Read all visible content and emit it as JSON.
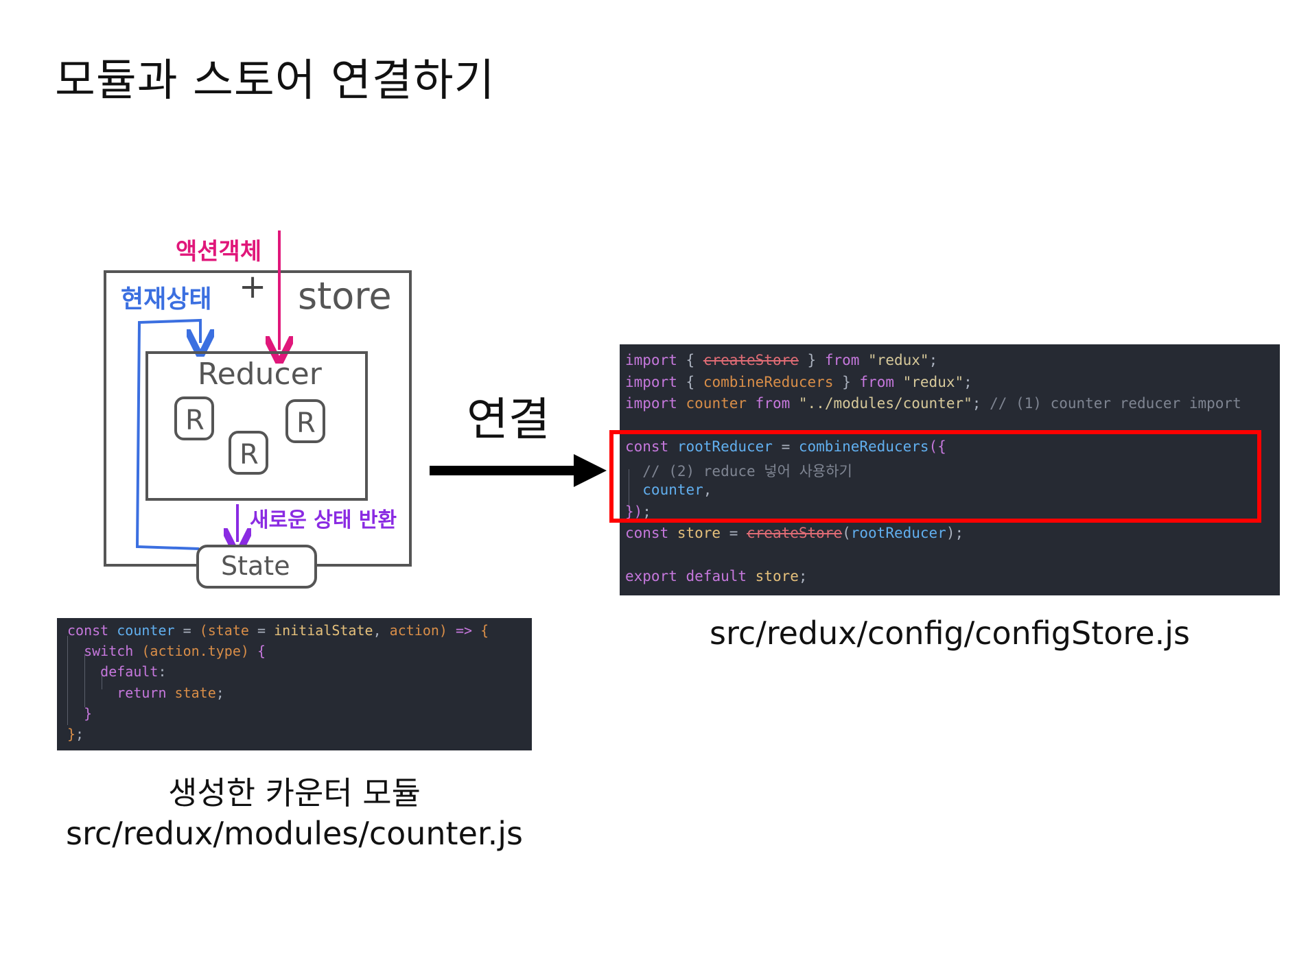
{
  "title": "모듈과 스토어 연결하기",
  "diagram": {
    "action_label": "액션객체",
    "current_state_label": "현재상태",
    "plus": "+",
    "store_label": "store",
    "reducer_label": "Reducer",
    "r_label": "R",
    "new_state_label": "새로운 상태 반환",
    "state_label": "State"
  },
  "connect_label": "연결",
  "config_code": {
    "lines": [
      [
        {
          "t": "import ",
          "c": "kw"
        },
        {
          "t": "{ ",
          "c": "pl"
        },
        {
          "t": "createStore",
          "c": "del"
        },
        {
          "t": " } ",
          "c": "pl"
        },
        {
          "t": "from ",
          "c": "kw"
        },
        {
          "t": "\"redux\"",
          "c": "str"
        },
        {
          "t": ";",
          "c": "pl"
        }
      ],
      [
        {
          "t": "import ",
          "c": "kw"
        },
        {
          "t": "{ ",
          "c": "pl"
        },
        {
          "t": "combineReducers",
          "c": "par"
        },
        {
          "t": " } ",
          "c": "pl"
        },
        {
          "t": "from ",
          "c": "kw"
        },
        {
          "t": "\"redux\"",
          "c": "str"
        },
        {
          "t": ";",
          "c": "pl"
        }
      ],
      [
        {
          "t": "import ",
          "c": "kw"
        },
        {
          "t": "counter ",
          "c": "par"
        },
        {
          "t": "from ",
          "c": "kw"
        },
        {
          "t": "\"../modules/counter\"",
          "c": "str"
        },
        {
          "t": "; ",
          "c": "pl"
        },
        {
          "t": "// (1) counter reducer import",
          "c": "cm"
        }
      ],
      [],
      [
        {
          "t": "const ",
          "c": "kw"
        },
        {
          "t": "rootReducer ",
          "c": "fn"
        },
        {
          "t": "= ",
          "c": "pl"
        },
        {
          "t": "combineReducers",
          "c": "fn"
        },
        {
          "t": "({",
          "c": "kw"
        }
      ],
      [
        {
          "t": "  // (2) reduce 넣어 사용하기",
          "c": "cm"
        }
      ],
      [
        {
          "t": "  counter",
          "c": "fn"
        },
        {
          "t": ",",
          "c": "pl"
        }
      ],
      [
        {
          "t": "})",
          "c": "kw"
        },
        {
          "t": ";",
          "c": "pl"
        }
      ],
      [
        {
          "t": "const ",
          "c": "kw"
        },
        {
          "t": "store ",
          "c": "var"
        },
        {
          "t": "= ",
          "c": "pl"
        },
        {
          "t": "createStore",
          "c": "del"
        },
        {
          "t": "(",
          "c": "pl"
        },
        {
          "t": "rootReducer",
          "c": "fn"
        },
        {
          "t": ");",
          "c": "pl"
        }
      ],
      [],
      [
        {
          "t": "export ",
          "c": "kw"
        },
        {
          "t": "default ",
          "c": "kw"
        },
        {
          "t": "store",
          "c": "var"
        },
        {
          "t": ";",
          "c": "pl"
        }
      ]
    ]
  },
  "config_caption": "src/redux/config/configStore.js",
  "counter_code": {
    "lines": [
      [
        {
          "t": "const ",
          "c": "kw"
        },
        {
          "t": "counter ",
          "c": "fn"
        },
        {
          "t": "= ",
          "c": "pl"
        },
        {
          "t": "(",
          "c": "par"
        },
        {
          "t": "state ",
          "c": "par"
        },
        {
          "t": "= ",
          "c": "pl"
        },
        {
          "t": "initialState",
          "c": "var"
        },
        {
          "t": ", ",
          "c": "pl"
        },
        {
          "t": "action",
          "c": "par"
        },
        {
          "t": ") ",
          "c": "par"
        },
        {
          "t": "=> ",
          "c": "kw"
        },
        {
          "t": "{",
          "c": "par"
        }
      ],
      [
        {
          "t": "  switch ",
          "c": "kw"
        },
        {
          "t": "(",
          "c": "par"
        },
        {
          "t": "action.type",
          "c": "par"
        },
        {
          "t": ") ",
          "c": "par"
        },
        {
          "t": "{",
          "c": "kw"
        }
      ],
      [
        {
          "t": "    default",
          "c": "kw"
        },
        {
          "t": ":",
          "c": "pl"
        }
      ],
      [
        {
          "t": "      return ",
          "c": "kw"
        },
        {
          "t": "state",
          "c": "par"
        },
        {
          "t": ";",
          "c": "pl"
        }
      ],
      [
        {
          "t": "  }",
          "c": "kw"
        }
      ],
      [
        {
          "t": "}",
          "c": "par"
        },
        {
          "t": ";",
          "c": "pl"
        }
      ]
    ]
  },
  "counter_caption_1": "생성한 카운터 모듈",
  "counter_caption_2": "src/redux/modules/counter.js",
  "colors": {
    "action_pink": "#e0177a",
    "current_blue": "#3b6fe0",
    "new_state_purple": "#8a2be2",
    "box_gray": "#555555",
    "highlight_red": "#ff0000",
    "code_bg": "#262a33"
  }
}
